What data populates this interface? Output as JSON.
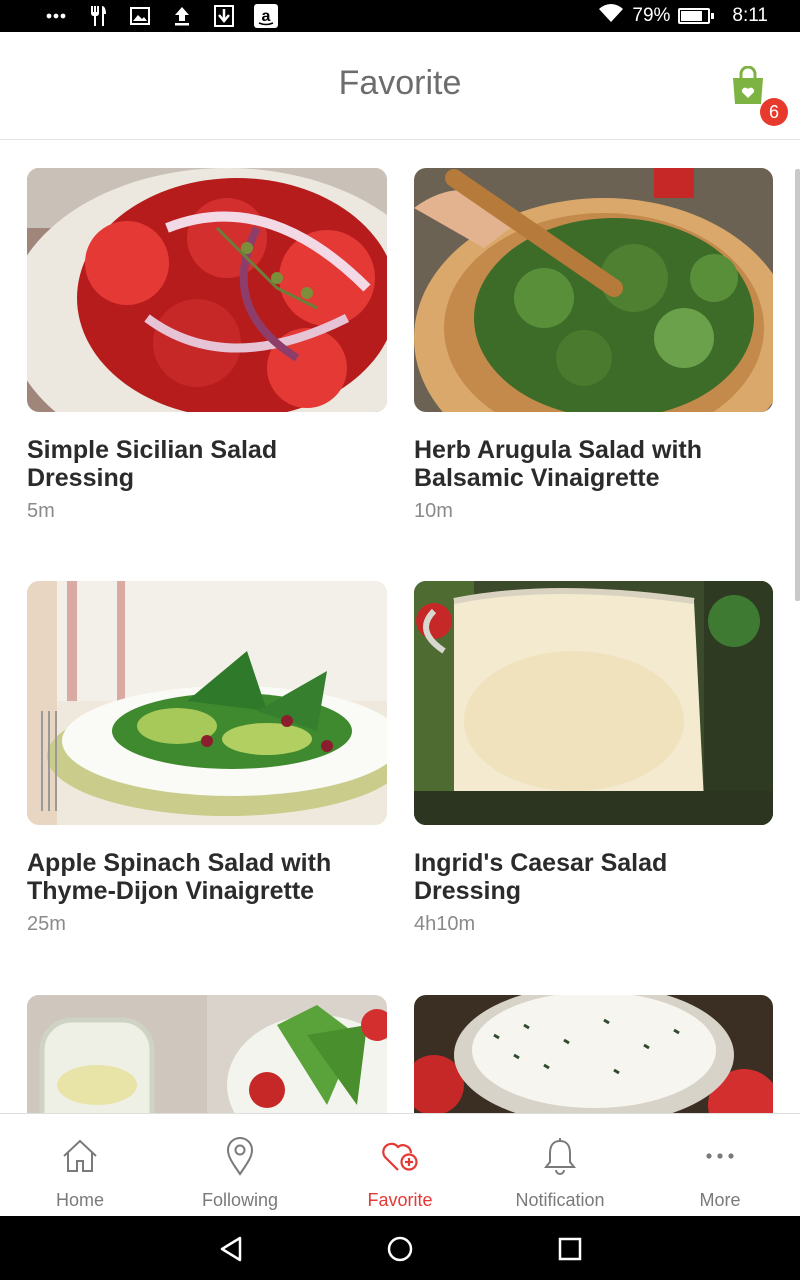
{
  "status_bar": {
    "left_icons": [
      "more-dots-icon",
      "utensils-icon",
      "image-icon",
      "upload-icon",
      "download-icon",
      "amazon-icon"
    ],
    "battery_percent": "79%",
    "battery_level": 0.79,
    "time": "8:11"
  },
  "header": {
    "title": "Favorite",
    "cart_badge": "6",
    "accent": "#7cb342"
  },
  "recipes": [
    {
      "name": "Simple Sicilian Salad Dressing",
      "time": "5m",
      "image": "tomato-onion-salad"
    },
    {
      "name": "Herb   Arugula Salad with Balsamic Vinaigrette",
      "time": "10m",
      "image": "arugula-bowl"
    },
    {
      "name": "Apple Spinach Salad with Thyme-Dijon Vinaigrette",
      "time": "25m",
      "image": "apple-spinach-plate"
    },
    {
      "name": "Ingrid's Caesar Salad Dressing",
      "time": "4h10m",
      "image": "caesar-dressing-pitcher"
    },
    {
      "name": "",
      "time": "",
      "image": "vinaigrette-jar-lettuce"
    },
    {
      "name": "",
      "time": "",
      "image": "ranch-dressing-bowl"
    }
  ],
  "bottom_nav": [
    {
      "label": "Home",
      "icon": "home-icon",
      "active": false
    },
    {
      "label": "Following",
      "icon": "location-pin-icon",
      "active": false
    },
    {
      "label": "Favorite",
      "icon": "heart-plus-icon",
      "active": true
    },
    {
      "label": "Notification",
      "icon": "bell-icon",
      "active": false
    },
    {
      "label": "More",
      "icon": "more-dots-icon",
      "active": false
    }
  ],
  "colors": {
    "active": "#e53935",
    "inactive": "#7a7a7a",
    "badge": "#e8392d"
  }
}
